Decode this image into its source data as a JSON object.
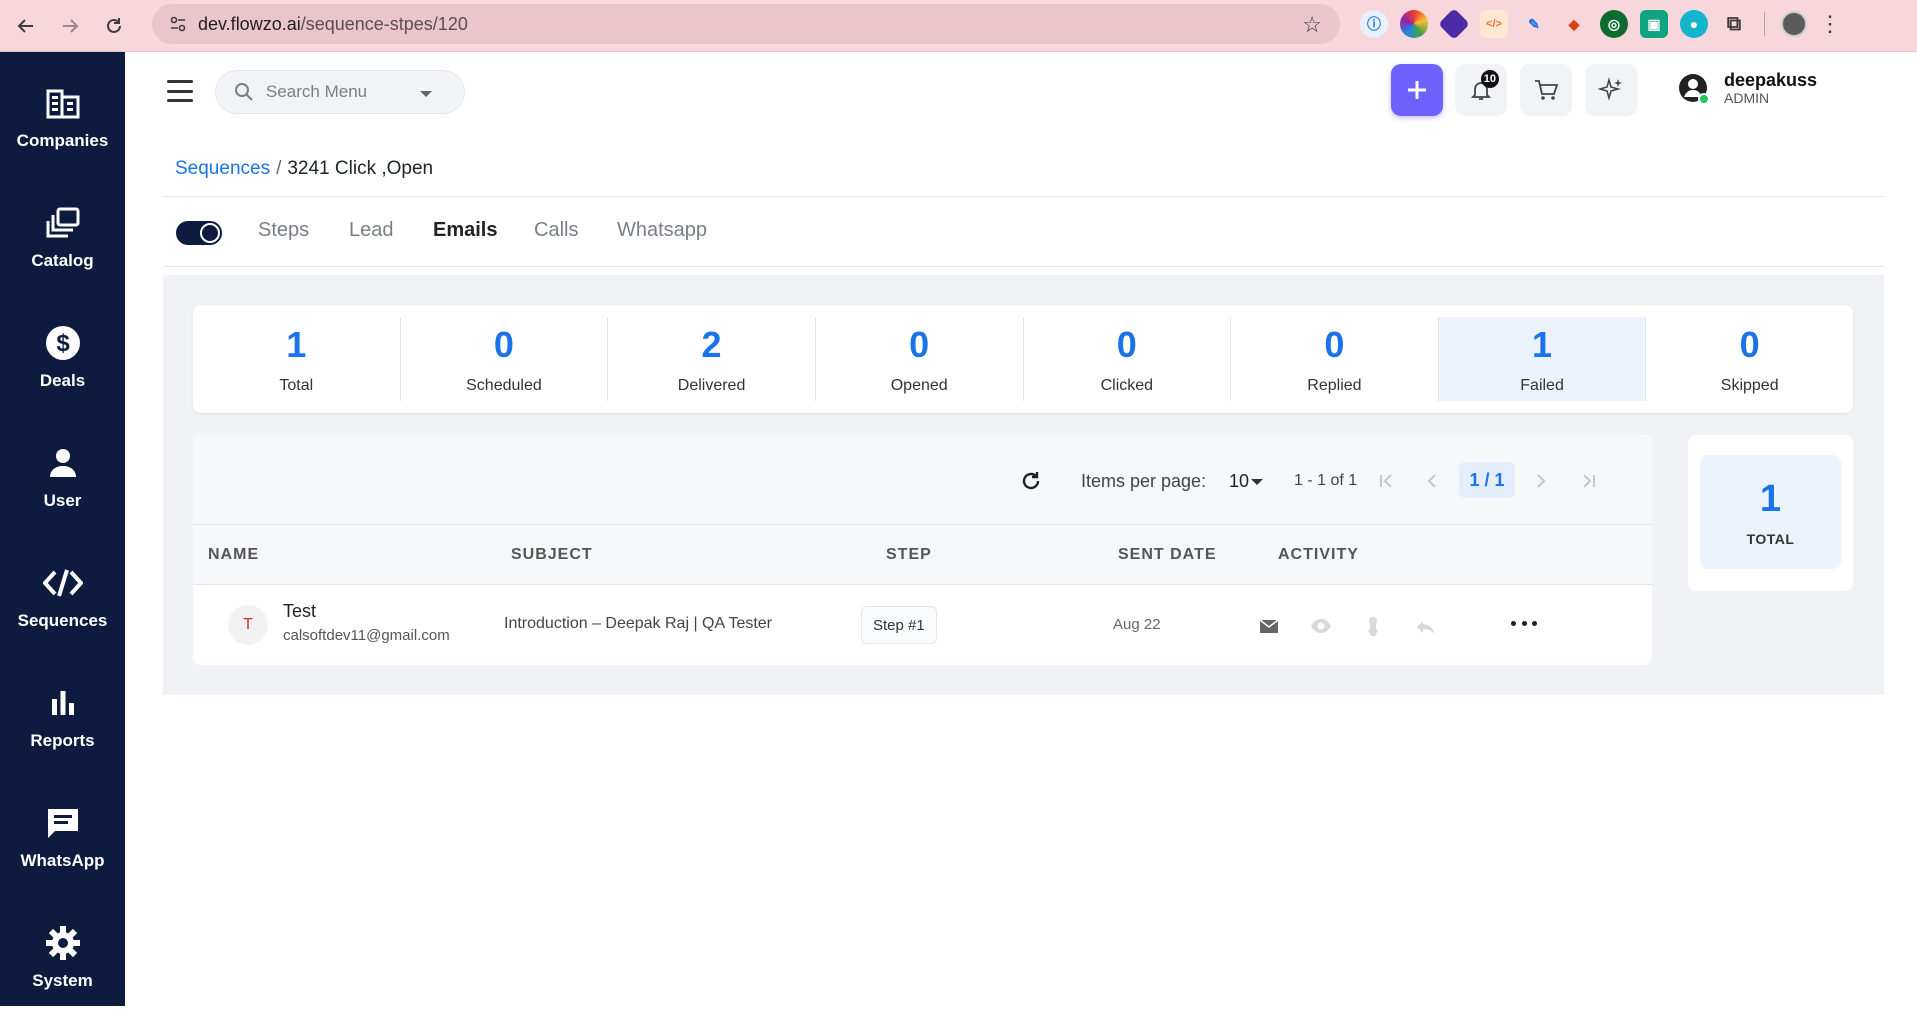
{
  "browser": {
    "url_host": "dev.flowzo.ai",
    "url_path": "/sequence-stpes/120"
  },
  "sidebar": {
    "items": [
      {
        "label": "Companies",
        "icon": "building-icon"
      },
      {
        "label": "Catalog",
        "icon": "catalog-icon"
      },
      {
        "label": "Deals",
        "icon": "dollar-icon"
      },
      {
        "label": "User",
        "icon": "person-icon"
      },
      {
        "label": "Sequences",
        "icon": "code-icon"
      },
      {
        "label": "Reports",
        "icon": "bar-chart-icon"
      },
      {
        "label": "WhatsApp",
        "icon": "chat-icon"
      },
      {
        "label": "System",
        "icon": "gear-icon"
      }
    ]
  },
  "header": {
    "search_placeholder": "Search Menu",
    "notification_count": "10",
    "user": {
      "name": "deepakuss",
      "role": "ADMIN"
    }
  },
  "breadcrumb": {
    "parent": "Sequences",
    "separator": "/",
    "current": "3241 Click ,Open"
  },
  "tabs": [
    "Steps",
    "Lead",
    "Emails",
    "Calls",
    "Whatsapp"
  ],
  "active_tab": "Emails",
  "stats": [
    {
      "value": "1",
      "label": "Total"
    },
    {
      "value": "0",
      "label": "Scheduled"
    },
    {
      "value": "2",
      "label": "Delivered"
    },
    {
      "value": "0",
      "label": "Opened"
    },
    {
      "value": "0",
      "label": "Clicked"
    },
    {
      "value": "0",
      "label": "Replied"
    },
    {
      "value": "1",
      "label": "Failed"
    },
    {
      "value": "0",
      "label": "Skipped"
    }
  ],
  "pagination": {
    "items_per_page_label": "Items per page:",
    "items_per_page": "10",
    "range": "1 - 1 of 1",
    "current": "1 / 1"
  },
  "table": {
    "columns": [
      "NAME",
      "SUBJECT",
      "STEP",
      "SENT DATE",
      "ACTIVITY"
    ],
    "rows": [
      {
        "initial": "T",
        "name": "Test",
        "email": "calsoftdev11@gmail.com",
        "subject": "Introduction – Deepak Raj | QA Tester",
        "step": "Step #1",
        "sent_date": "Aug 22"
      }
    ]
  },
  "total_card": {
    "value": "1",
    "label": "TOTAL"
  },
  "colors": {
    "sidebar_bg": "#0d1b3e",
    "accent": "#1a73e8",
    "primary_button": "#6c63ff"
  }
}
